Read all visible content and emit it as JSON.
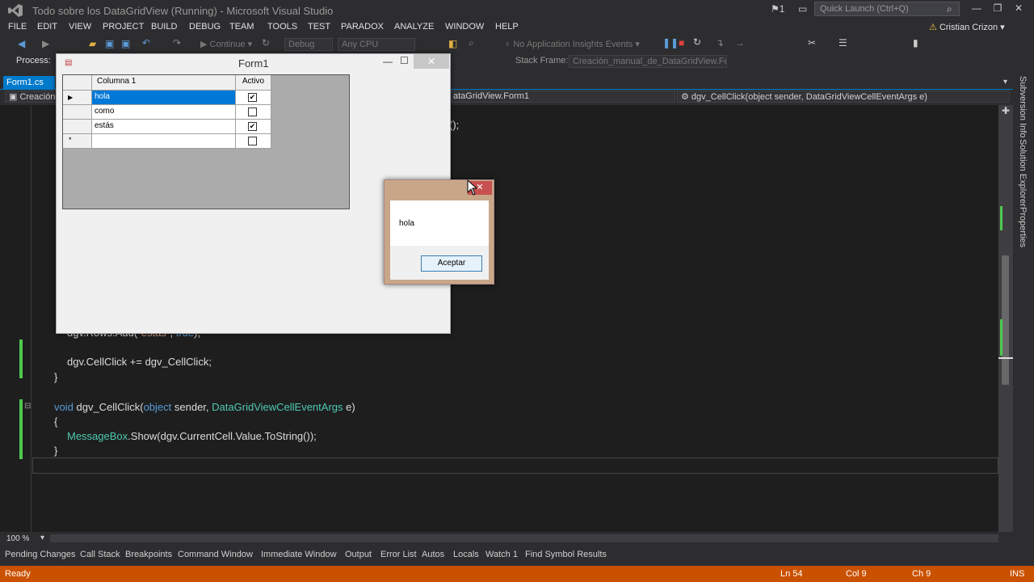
{
  "window": {
    "title": "Todo sobre los DataGridView (Running) - Microsoft Visual Studio",
    "notification_count": "1",
    "quick_launch_placeholder": "Quick Launch (Ctrl+Q)",
    "user": "Cristian Crizon"
  },
  "menu": [
    "FILE",
    "EDIT",
    "VIEW",
    "PROJECT",
    "BUILD",
    "DEBUG",
    "TEAM",
    "TOOLS",
    "TEST",
    "PARADOX",
    "ANALYZE",
    "WINDOW",
    "HELP"
  ],
  "toolbar": {
    "continue": "Continue",
    "config": "Debug",
    "platform": "Any CPU",
    "insights": "No Application Insights Events",
    "process_label": "Process:",
    "stack_frame_label": "Stack Frame:",
    "stack_frame_value": "Creación_manual_de_DataGridView.Form"
  },
  "tabs": {
    "active": "Form1.cs"
  },
  "navbar": {
    "project": "Creación",
    "class": "ataGridView.Form1",
    "member": "dgv_CellClick(object sender, DataGridViewCellEventArgs e)"
  },
  "code": {
    "line_top_fragment": "();",
    "line_rows_add": "dgv.Rows.Add(\"estás\", true);",
    "line_event": "dgv.CellClick += dgv_CellClick;",
    "brace_close": "}",
    "sig_kw": "void",
    "sig_name": "dgv_CellClick(",
    "sig_obj": "object",
    "sig_sender": "sender,",
    "sig_type": "DataGridViewCellEventArgs",
    "sig_e": "e)",
    "brace_open": "{",
    "body_type": "MessageBox",
    "body_rest": ".Show(dgv.CurrentCell.Value.ToString());",
    "brace_end": "}"
  },
  "right_panel": [
    "Subversion Info",
    "Solution Explorer",
    "Properties"
  ],
  "zoom": "100 %",
  "bottom_tabs": [
    "Pending Changes",
    "Call Stack",
    "Breakpoints",
    "Command Window",
    "Immediate Window",
    "Output",
    "Error List",
    "Autos",
    "Locals",
    "Watch 1",
    "Find Symbol Results"
  ],
  "status": {
    "state": "Ready",
    "ln": "Ln 54",
    "col": "Col 9",
    "ch": "Ch 9",
    "mode": "INS"
  },
  "form1": {
    "title": "Form1",
    "columns": [
      "Columna 1",
      "Activo"
    ],
    "rows": [
      {
        "text": "hola",
        "active": true,
        "selected": true
      },
      {
        "text": "como",
        "active": false,
        "selected": false
      },
      {
        "text": "estás",
        "active": true,
        "selected": false
      },
      {
        "text": "",
        "active": false,
        "selected": false,
        "new_row": true
      }
    ]
  },
  "msgbox": {
    "text": "hola",
    "ok": "Aceptar"
  }
}
